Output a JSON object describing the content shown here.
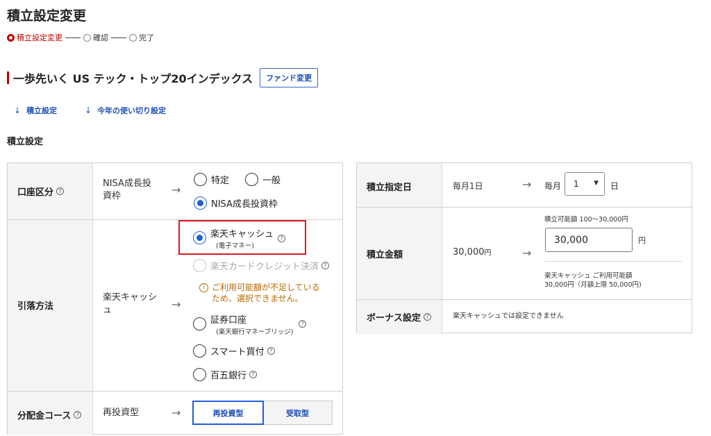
{
  "page_title": "積立設定変更",
  "steps": [
    {
      "label": "積立設定変更",
      "active": true
    },
    {
      "label": "確認",
      "active": false
    },
    {
      "label": "完了",
      "active": false
    }
  ],
  "fund": {
    "name": "一歩先いく US テック・トップ20インデックス",
    "change_button": "ファンド変更"
  },
  "anchors": {
    "tsumitate": "積立設定",
    "tsukaikiri": "今年の使い切り設定"
  },
  "section_title": "積立設定",
  "left_card": {
    "account": {
      "label": "口座区分",
      "current_line1": "NISA成長投",
      "current_line2": "資枠",
      "options": [
        "特定",
        "一般",
        "NISA成長投資枠"
      ]
    },
    "payment": {
      "label": "引落方法",
      "current_line1": "楽天キャッシ",
      "current_line2": "ュ",
      "rakuten_cash": "楽天キャッシュ",
      "rakuten_cash_sub": "(電子マネー)",
      "credit": "楽天カードクレジット決済",
      "notice_line1": "ご利用可能額が不足している",
      "notice_line2": "ため、選択できません。",
      "securities": "証券口座",
      "securities_sub": "(楽天銀行マネーブリッジ)",
      "smart": "スマート買付",
      "bank": "百五銀行"
    },
    "distribution": {
      "label": "分配金コース",
      "current": "再投資型",
      "options": [
        "再投資型",
        "受取型"
      ]
    }
  },
  "right_card": {
    "date": {
      "label": "積立指定日",
      "current": "毎月1日",
      "prefix": "毎月",
      "value": "1",
      "suffix": "日"
    },
    "amount": {
      "label": "積立金額",
      "range_note": "積立可能額 100〜30,000円",
      "current_value": "30,000",
      "current_unit": "円",
      "input_value": "30,000",
      "unit": "円",
      "available_line1": "楽天キャッシュ ご利用可能額",
      "available_line2": "30,000円（月額上限 50,000円)"
    },
    "bonus": {
      "label": "ボーナス設定",
      "text": "楽天キャッシュでは設定できません"
    }
  },
  "icons": {
    "help": "?",
    "info": "i",
    "arrow_right": "→",
    "arrow_down": "↓",
    "caret": "▼"
  },
  "colors": {
    "accent_red": "#bf0000",
    "link_blue": "#1d4fb8",
    "radio_blue": "#1f5fd6",
    "notice_orange": "#b86a00",
    "highlight_red": "#e0141e"
  }
}
